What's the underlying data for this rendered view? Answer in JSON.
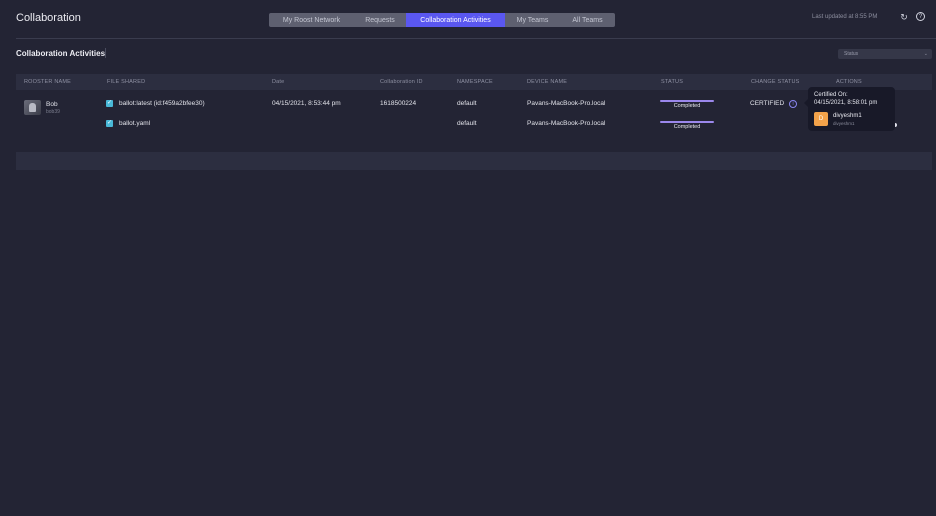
{
  "app": {
    "title": "Collaboration"
  },
  "tabs": [
    {
      "label": "My Roost Network",
      "active": false
    },
    {
      "label": "Requests",
      "active": false
    },
    {
      "label": "Collaboration Activities",
      "active": true
    },
    {
      "label": "My Teams",
      "active": false
    },
    {
      "label": "All Teams",
      "active": false
    }
  ],
  "header": {
    "last_updated": "Last updated at 8:55 PM",
    "refresh_icon": "refresh-icon",
    "help_icon": "help-icon"
  },
  "section": {
    "title": "Collaboration Activities",
    "filter_placeholder": "Status"
  },
  "table": {
    "columns": [
      "ROOSTER NAME",
      "FILE SHARED",
      "Date",
      "Collaboration ID",
      "NAMESPACE",
      "DEVICE NAME",
      "STATUS",
      "CHANGE STATUS",
      "ACTIONS"
    ],
    "rows": [
      {
        "user_name": "Bob",
        "user_handle": "bob39",
        "file": "ballot:latest (id:f459a2bfee30)",
        "date": "04/15/2021, 8:53:44 pm",
        "collab_id": "1618500224",
        "namespace": "default",
        "device": "Pavans-MacBook-Pro.local",
        "status": "Completed",
        "status_progress": 1.0,
        "change_status": "CERTIFIED"
      },
      {
        "file": "ballot.yaml",
        "namespace": "default",
        "device": "Pavans-MacBook-Pro.local",
        "status": "Completed",
        "status_progress": 1.0
      }
    ]
  },
  "tooltip": {
    "label": "Certified On:",
    "timestamp": "04/15/2021, 8:58:01 pm",
    "avatar_letter": "D",
    "user": "divyeshm1",
    "handle": "divyeshm1"
  },
  "colors": {
    "accent": "#5a57f0",
    "background": "#232434",
    "progress": "#9b88ec",
    "checkbox": "#49b9d8",
    "avatar": "#f2a24a"
  }
}
